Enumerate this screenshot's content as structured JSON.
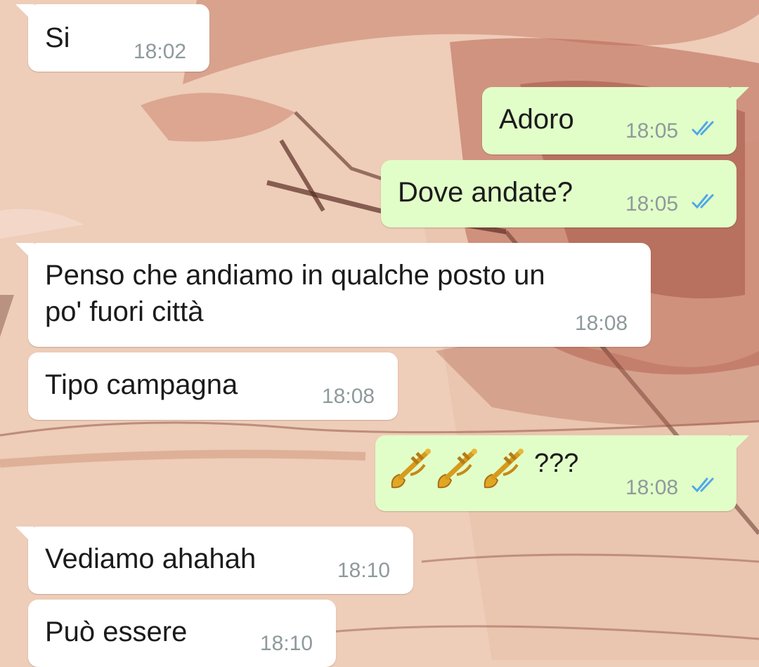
{
  "chat": {
    "messages": [
      {
        "direction": "in",
        "text": "Si",
        "time": "18:02"
      },
      {
        "direction": "out",
        "text": "Adoro",
        "time": "18:05",
        "status": "read"
      },
      {
        "direction": "out",
        "text": "Dove andate?",
        "time": "18:05",
        "status": "read"
      },
      {
        "direction": "in",
        "text": "Penso che andiamo in qualche posto un\npo' fuori città",
        "time": "18:08"
      },
      {
        "direction": "in",
        "text": "Tipo campagna",
        "time": "18:08"
      },
      {
        "direction": "out",
        "emoji": [
          "trumpet",
          "trumpet",
          "trumpet"
        ],
        "text": "???",
        "time": "18:08",
        "status": "read"
      },
      {
        "direction": "in",
        "text": "Vediamo ahahah",
        "time": "18:10"
      },
      {
        "direction": "in",
        "text": "Può essere",
        "time": "18:10"
      }
    ]
  },
  "icons": {
    "read_receipt": "double-check-icon",
    "emoji": "trumpet-emoji"
  },
  "colors": {
    "incoming_bubble": "#ffffff",
    "outgoing_bubble": "#e2fec8",
    "read_receipt": "#4fa8e8",
    "timestamp": "#8e9a9c",
    "wallpaper": "#eecdb9"
  }
}
